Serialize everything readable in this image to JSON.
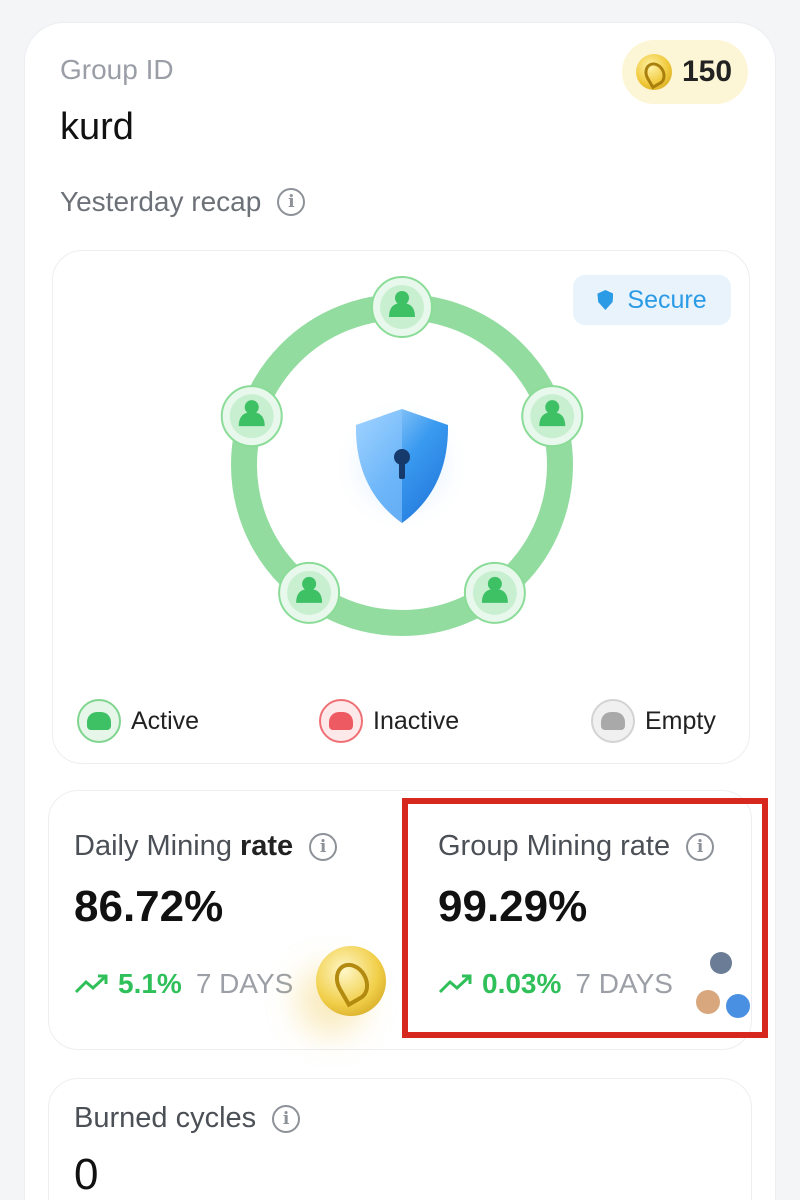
{
  "header": {
    "group_id_label": "Group ID",
    "group_id_value": "kurd",
    "coins": "150",
    "coin_icon": "coin-icon"
  },
  "recap": {
    "title": "Yesterday recap",
    "secure_label": "Secure",
    "members": [
      {
        "status": "active"
      },
      {
        "status": "active"
      },
      {
        "status": "active"
      },
      {
        "status": "active"
      },
      {
        "status": "active"
      }
    ],
    "legend": {
      "active": "Active",
      "inactive": "Inactive",
      "empty": "Empty"
    },
    "colors": {
      "active": "#3ec064",
      "inactive": "#ee5a61",
      "empty": "#a9a9a9",
      "ring": "#7fd68e",
      "secure": "#2b9be6"
    }
  },
  "daily_mining": {
    "label_prefix": "Daily Mining",
    "label_bold": "rate",
    "value": "86.72%",
    "change": "5.1%",
    "period": "7 DAYS"
  },
  "group_mining": {
    "label": "Group Mining rate",
    "value": "99.29%",
    "change": "0.03%",
    "period": "7 DAYS"
  },
  "burned": {
    "label": "Burned cycles",
    "value": "0"
  }
}
